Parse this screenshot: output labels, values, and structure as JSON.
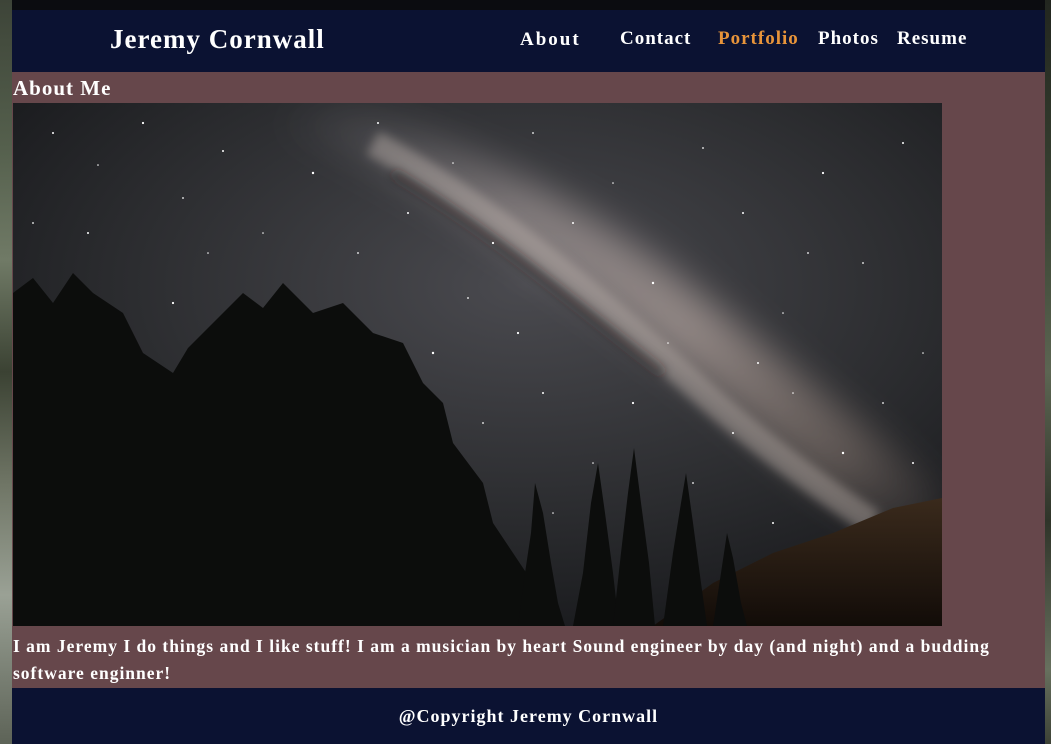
{
  "header": {
    "site_title": "Jeremy Cornwall",
    "nav": {
      "about": "About",
      "contact": "Contact",
      "portfolio": "Portfolio",
      "photos": "Photos",
      "resume": "Resume"
    },
    "active_item": "portfolio"
  },
  "main": {
    "section_title": "About Me",
    "photo_icon": "night-sky-milky-way-photo",
    "about_text": "I am Jeremy I do things and I like stuff! I am a musician by heart Sound engineer by day (and night) and a budding software enginner!"
  },
  "footer": {
    "copyright": "@Copyright Jeremy Cornwall"
  },
  "colors": {
    "header_bg": "#0b1232",
    "main_bg": "#66474b",
    "active_link": "#e8943a",
    "text": "#ffffff"
  }
}
